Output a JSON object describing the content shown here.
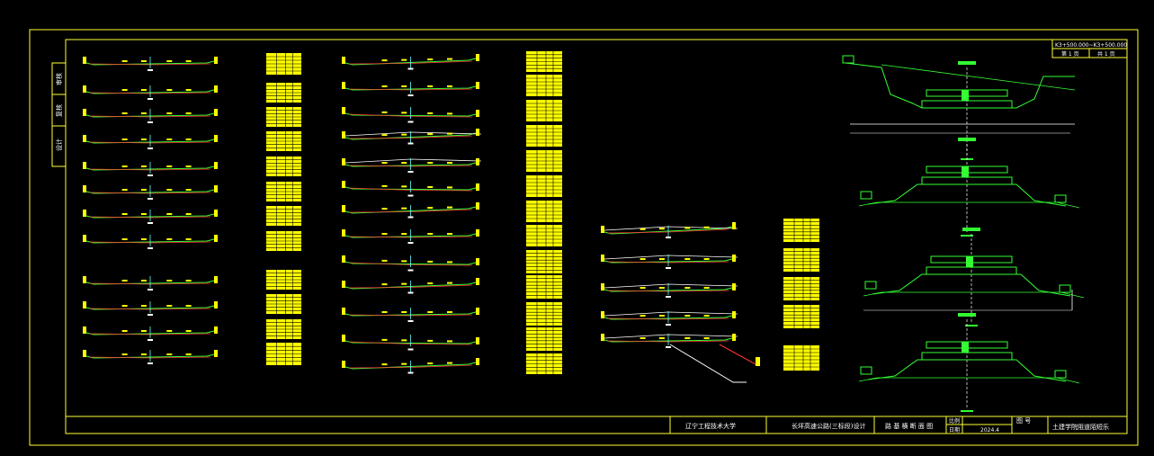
{
  "drawing": {
    "background": "#000000",
    "colors": {
      "frame": "#ffff33",
      "road": "#33ff33",
      "design": "#ff3333",
      "ground": "#ffffff",
      "pole": "#ffff00",
      "cyan": "#66ffff",
      "table": "#ffff00"
    },
    "side_stamp": [
      "审核",
      "复核",
      "设计"
    ],
    "station_range": "K3+500.000~K3+500.000",
    "sheet": {
      "left": "第 1 页",
      "right": "共 1 页"
    },
    "title_block": {
      "school": "辽宁工程技术大学",
      "project": "长坪高速公路(三标段)设计",
      "drawing_title": "路 基 横 断 面 图",
      "scale_label": "比例",
      "date_label": "日期",
      "date_value": "2024.4",
      "drawing_no_label": "图 号",
      "author": "土建学院阻道陌短乐"
    }
  }
}
